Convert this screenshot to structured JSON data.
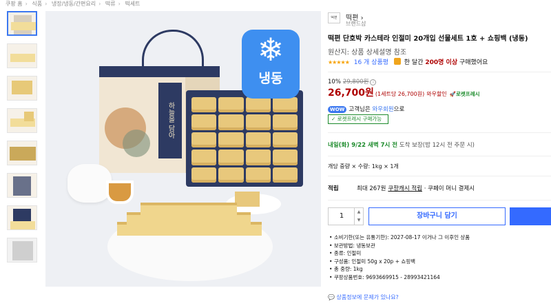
{
  "breadcrumb": [
    "쿠팡 홈",
    "식품",
    "냉장/냉동/간편요리",
    "떡류",
    "떡세트"
  ],
  "thumbnails": [
    "thumbnail-1",
    "thumbnail-2",
    "thumbnail-3",
    "thumbnail-4",
    "thumbnail-5",
    "thumbnail-6",
    "thumbnail-7",
    "thumbnail-8"
  ],
  "image": {
    "freeze_label": "냉동",
    "freeze_icon": "❄",
    "bag_text": "하늘을 담아"
  },
  "brand": {
    "logo": "떡편",
    "name": "떡편",
    "sub": "브랜드샵"
  },
  "product": {
    "title": "떡편 단호박 카스테라 인절미 20개입 선물세트 1호 + 쇼핑백 (냉동)",
    "origin": "원산지: 상품 상세설명 참조",
    "stars": "★★★★★",
    "reviews": "16 개 상품평",
    "buy_prefix": "한 달간",
    "buy_count": "200명 이상",
    "buy_suffix": "구매했어요"
  },
  "price": {
    "discount": "10%",
    "original": "29,800원",
    "final": "26,700원",
    "unit": "(1세트당 26,700원)",
    "wow_discount": "와우할인",
    "rocket": "🚀로켓프레시"
  },
  "wow": {
    "badge": "WOW",
    "text_before": "고객님은",
    "link": "와우회원",
    "text_after": "으로",
    "rocket_button": "✓ 로켓프레시 구매가능"
  },
  "delivery": {
    "date": "내일(화) 9/22 새벽 7시 전",
    "guarantee": "도착 보장",
    "note": "(밤 12시 전 주문 시)"
  },
  "option": "개당 중량 × 수량: 1kg × 1개",
  "reward": {
    "label": "적립",
    "text": "최대 267원",
    "link": "쿠팡캐시 적립",
    "suffix": "· 쿠페이 머니 결제시"
  },
  "quantity": {
    "value": "1",
    "up": "▲",
    "down": "▼"
  },
  "cart_button": "장바구니 담기",
  "specs": [
    "소비기한(또는 유통기한): 2027-08-17 이거나 그 이후인 상품",
    "보관방법: 냉동보관",
    "종류: 인절미",
    "구성품: 인절미 50g x 20p + 쇼핑백",
    "총 중량: 1kg",
    "쿠팡상품번호: 9693669915 - 28993421164"
  ],
  "report_link": "상품정보에 문제가 있나요?",
  "colors": {
    "accent_blue": "#346aff",
    "price_red": "#ae0000",
    "rocket_green": "#1b8a2a",
    "freeze_blue": "#3e8ff0"
  }
}
